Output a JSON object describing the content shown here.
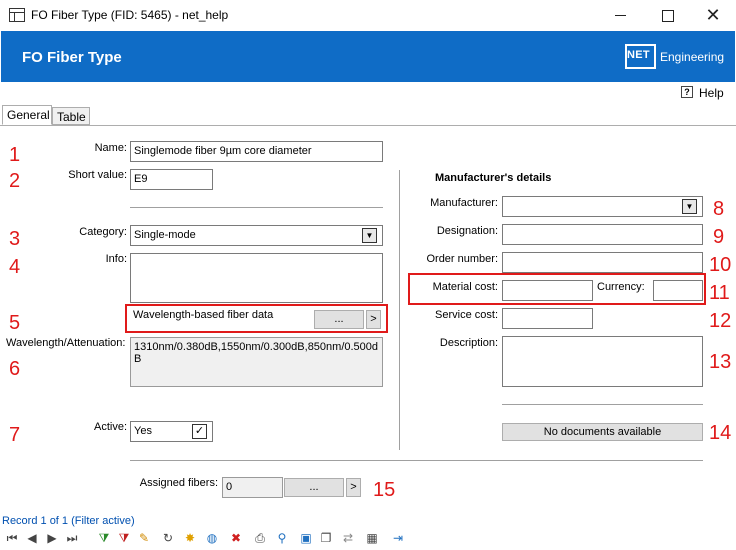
{
  "window": {
    "title": "FO Fiber Type (FID: 5465) - net_help",
    "minimize": "",
    "maximize": "",
    "close": "✕"
  },
  "header": {
    "title": "FO Fiber Type",
    "logo_net": "NET",
    "logo_engineering": "Engineering"
  },
  "help": {
    "label": "Help",
    "icon": "?"
  },
  "tabs": [
    {
      "label": "General",
      "active": true
    },
    {
      "label": "Table",
      "active": false
    }
  ],
  "form": {
    "name_label": "Name:",
    "name_value": "Singlemode fiber 9µm core diameter",
    "short_label": "Short value:",
    "short_value": "E9",
    "category_label": "Category:",
    "category_value": "Single-mode",
    "info_label": "Info:",
    "info_value": "",
    "wavelength_data_label": "Wavelength-based fiber data",
    "wavelength_data_btn": "...",
    "wavelength_data_arrow": ">",
    "wavelength_label": "Wavelength/Attenuation:",
    "wavelength_value_line1": "1310nm/0.380dB,1550nm/0.300dB,850nm/0.500d",
    "wavelength_value_line2": "B",
    "active_label": "Active:",
    "active_value": "Yes",
    "active_check": "✓",
    "assigned_label": "Assigned fibers:",
    "assigned_value": "0",
    "assigned_btn": "...",
    "assigned_arrow": ">"
  },
  "manufacturer": {
    "section_title": "Manufacturer's details",
    "manufacturer_label": "Manufacturer:",
    "manufacturer_value": "",
    "designation_label": "Designation:",
    "order_label": "Order number:",
    "material_cost_label": "Material cost:",
    "currency_label": "Currency:",
    "service_cost_label": "Service cost:",
    "description_label": "Description:",
    "documents_button": "No documents available"
  },
  "annotations": [
    "1",
    "2",
    "3",
    "4",
    "5",
    "6",
    "7",
    "8",
    "9",
    "10",
    "11",
    "12",
    "13",
    "14",
    "15"
  ],
  "status": {
    "record_text": "Record 1 of 1 (Filter active)"
  },
  "toolbar": {
    "icons": [
      {
        "name": "first-record-icon",
        "glyph": "⏮",
        "color": "#444"
      },
      {
        "name": "previous-record-icon",
        "glyph": "◀",
        "color": "#444"
      },
      {
        "name": "next-record-icon",
        "glyph": "▶",
        "color": "#444"
      },
      {
        "name": "last-record-icon",
        "glyph": "⏭",
        "color": "#444"
      },
      {
        "name": "add-filter-icon",
        "glyph": "⧩",
        "color": "#2a8a2a"
      },
      {
        "name": "remove-filter-icon",
        "glyph": "⧩",
        "color": "#c02020"
      },
      {
        "name": "edit-icon",
        "glyph": "✎",
        "color": "#d08a00"
      },
      {
        "name": "refresh-icon",
        "glyph": "↻",
        "color": "#444"
      },
      {
        "name": "new-icon",
        "glyph": "✸",
        "color": "#e0a000"
      },
      {
        "name": "web-icon",
        "glyph": "◍",
        "color": "#2070c0"
      },
      {
        "name": "delete-icon",
        "glyph": "✖",
        "color": "#d02020"
      },
      {
        "name": "print-icon",
        "glyph": "⎙",
        "color": "#444"
      },
      {
        "name": "search-icon",
        "glyph": "⚲",
        "color": "#2070c0"
      },
      {
        "name": "select-icon",
        "glyph": "▣",
        "color": "#2070c0"
      },
      {
        "name": "copy-icon",
        "glyph": "❐",
        "color": "#444"
      },
      {
        "name": "link-icon",
        "glyph": "⇄",
        "color": "#888"
      },
      {
        "name": "table-icon",
        "glyph": "▦",
        "color": "#444"
      },
      {
        "name": "exit-icon",
        "glyph": "⇥",
        "color": "#2070c0"
      }
    ]
  },
  "colors": {
    "header_bg": "#0f6cc6",
    "annotation_red": "#e01a1a",
    "record_text": "#0050b0"
  }
}
